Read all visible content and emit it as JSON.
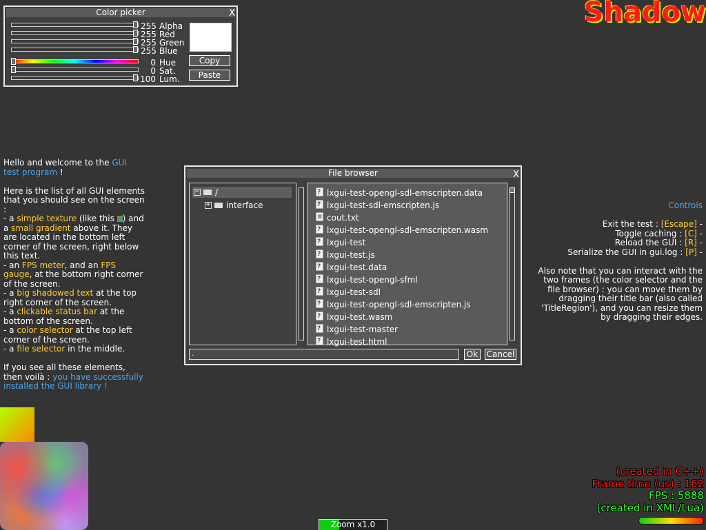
{
  "shadow_title": "Shadow",
  "color_picker": {
    "title": "Color picker",
    "close": "X",
    "sliders": [
      {
        "value": "255",
        "label": "Alpha",
        "level": 1.0
      },
      {
        "value": "255",
        "label": "Red",
        "level": 1.0
      },
      {
        "value": "255",
        "label": "Green",
        "level": 1.0
      },
      {
        "value": "255",
        "label": "Blue",
        "level": 1.0
      },
      {
        "value": "0",
        "label": "Hue",
        "level": 0.0
      },
      {
        "value": "0",
        "label": "Sat.",
        "level": 0.0
      },
      {
        "value": "100",
        "label": "Lum.",
        "level": 1.0
      }
    ],
    "copy_label": "Copy",
    "paste_label": "Paste",
    "preview_color": "#ffffff"
  },
  "welcome": {
    "p1_a": "Hello and welcome to the ",
    "p1_link": "GUI test program",
    "p1_b": " !",
    "p2_intro": "Here is the list of all GUI elements that you should see on the screen :",
    "i1_a": "  - a ",
    "i1_h1": "simple texture",
    "i1_b": " (like this ",
    "i1_c": ") and a ",
    "i1_h2": "small gradient",
    "i1_d": " above it. They are located in the bottom left corner of the screen, right below this text.",
    "i2_a": "  - an ",
    "i2_h1": "FPS meter",
    "i2_b": ", and an ",
    "i2_h2": "FPS gauge",
    "i2_c": ", at the bottom right corner of the screen.",
    "i3_a": "  - a ",
    "i3_h": "big shadowed text",
    "i3_b": " at the top right corner of the screen.",
    "i4_a": "  - a ",
    "i4_h": "clickable status bar",
    "i4_b": " at the bottom of the screen.",
    "i5_a": "  - a ",
    "i5_h": "color selector",
    "i5_b": " at the top left corner of the screen.",
    "i6_a": "  - a ",
    "i6_h": "file selector",
    "i6_b": " in the middle.",
    "p3_a": "If you see all these elements, then voilà : ",
    "p3_link": "you have successfully installed the GUI library !"
  },
  "file_browser": {
    "title": "File browser",
    "close": "X",
    "tree_root": "/",
    "tree_child": "interface",
    "files": [
      {
        "name": "lxgui-test-opengl-sdl-emscripten.data",
        "icon": "unknown-file-icon"
      },
      {
        "name": "lxgui-test-sdl-emscripten.js",
        "icon": "unknown-file-icon"
      },
      {
        "name": "cout.txt",
        "icon": "text-file-icon"
      },
      {
        "name": "lxgui-test-opengl-sdl-emscripten.wasm",
        "icon": "unknown-file-icon"
      },
      {
        "name": "lxgui-test",
        "icon": "unknown-file-icon"
      },
      {
        "name": "lxgui-test.js",
        "icon": "unknown-file-icon"
      },
      {
        "name": "lxgui-test.data",
        "icon": "unknown-file-icon"
      },
      {
        "name": "lxgui-test-opengl-sfml",
        "icon": "unknown-file-icon"
      },
      {
        "name": "lxgui-test-sdl",
        "icon": "unknown-file-icon"
      },
      {
        "name": "lxgui-test-opengl-sdl-emscripten.js",
        "icon": "unknown-file-icon"
      },
      {
        "name": "lxgui-test.wasm",
        "icon": "unknown-file-icon"
      },
      {
        "name": "lxgui-test-master",
        "icon": "unknown-file-icon"
      },
      {
        "name": "lxgui-test.html",
        "icon": "unknown-file-icon"
      }
    ],
    "path_value": ".",
    "ok_label": "Ok",
    "cancel_label": "Cancel"
  },
  "controls": {
    "title": "Controls",
    "lines": [
      {
        "a": "Exit the test : ",
        "key": "[Escape]",
        "b": " -"
      },
      {
        "a": "Toggle caching : ",
        "key": "[C]",
        "b": " -"
      },
      {
        "a": "Reload the GUI : ",
        "key": "[R]",
        "b": " -"
      },
      {
        "a": "Serialize the GUI in gui.log : ",
        "key": "[P]",
        "b": " -"
      }
    ],
    "note": "Also note that you can interact with the two frames (the color selector and the file browser) : you can move them by dragging their title bar (also called 'TitleRegion'), and you can resize them by dragging their edges."
  },
  "stats": {
    "created_cpp": "(created in C++)",
    "frame_time": "Frame time (us) : 162",
    "fps": "FPS : 5888",
    "created_xml": "(created in XML/Lua)"
  },
  "status_bar": {
    "label": "Zoom x1.0",
    "fill": 0.3
  },
  "colors": {
    "highlight_blue": "#4fa3e6",
    "highlight_yellow": "#ffcc33",
    "stat_red": "#ff1a1a",
    "stat_green": "#33ff33"
  }
}
